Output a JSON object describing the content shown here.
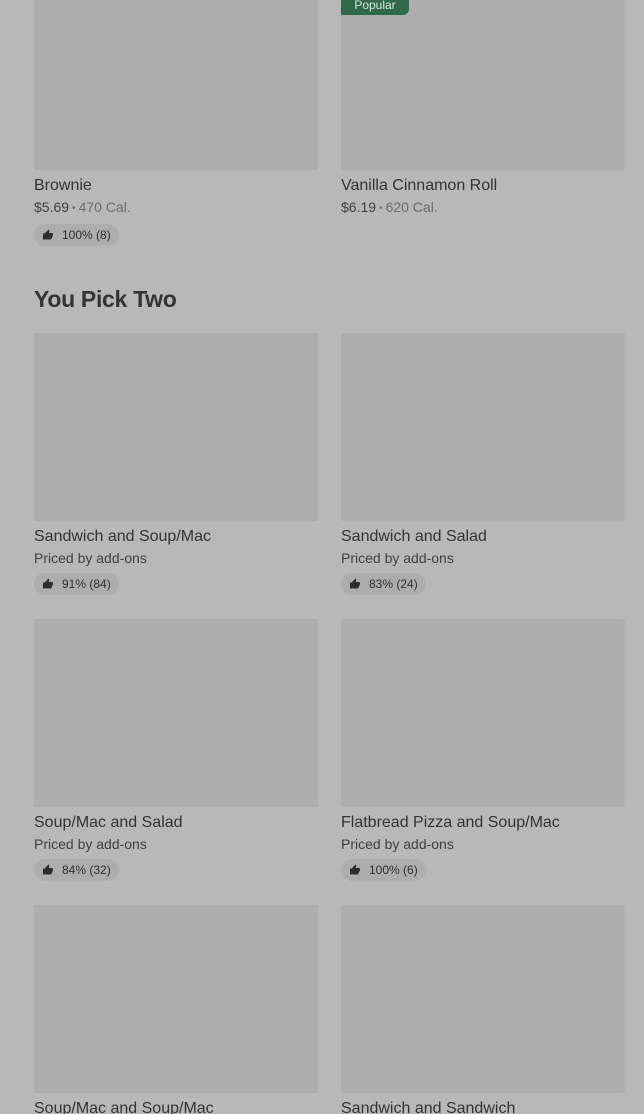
{
  "top_items": [
    {
      "name": "Brownie",
      "price": "$5.69",
      "calories": "470 Cal.",
      "rating": "100% (8)"
    },
    {
      "name": "Vanilla Cinnamon Roll",
      "price": "$6.19",
      "calories": "620 Cal.",
      "badge": "Popular"
    }
  ],
  "section": {
    "title": "You Pick Two"
  },
  "pick_two_items": [
    {
      "name": "Sandwich and Soup/Mac",
      "price": "Priced by add-ons",
      "rating": "91% (84)"
    },
    {
      "name": "Sandwich and Salad",
      "price": "Priced by add-ons",
      "rating": "83% (24)"
    },
    {
      "name": "Soup/Mac and Salad",
      "price": "Priced by add-ons",
      "rating": "84% (32)"
    },
    {
      "name": "Flatbread Pizza and Soup/Mac",
      "price": "Priced by add-ons",
      "rating": "100% (6)"
    },
    {
      "name": "Soup/Mac and Soup/Mac"
    },
    {
      "name": "Sandwich and Sandwich"
    }
  ],
  "meta_separator": "•",
  "colors": {
    "background": "#b8b8b8",
    "image_placeholder": "#adadad",
    "badge_green": "#2f6a4a"
  },
  "icons": {
    "rating": "thumbs-up-icon"
  }
}
